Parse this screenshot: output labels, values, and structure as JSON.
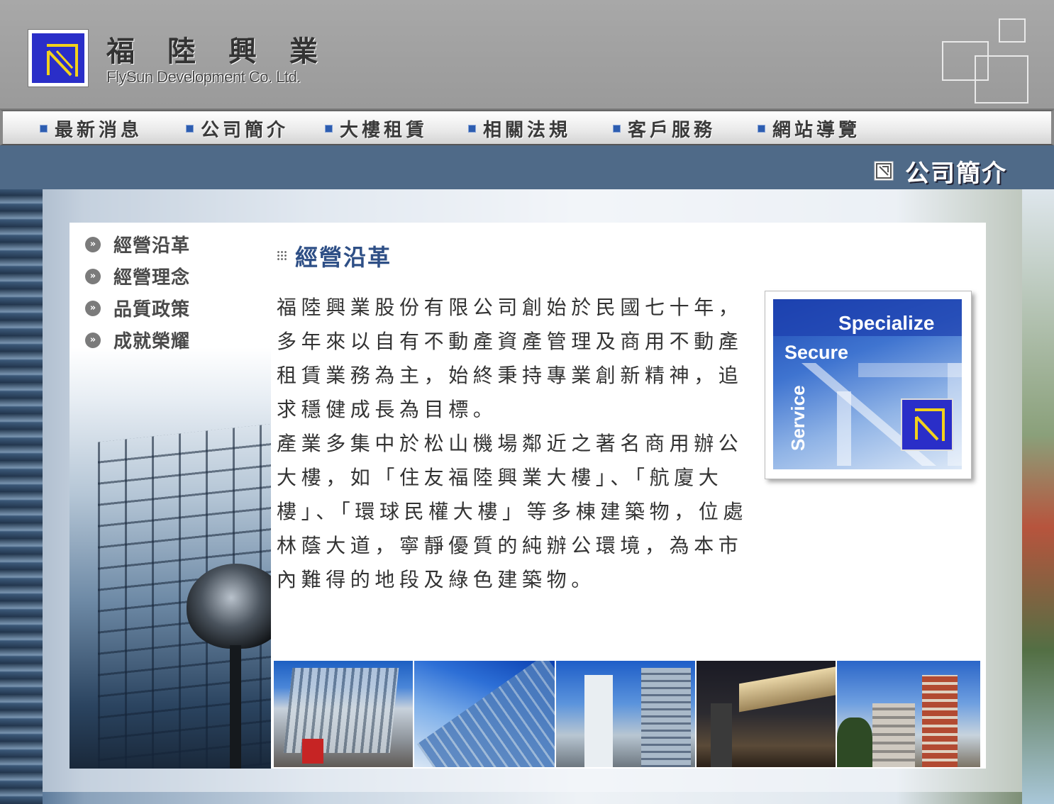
{
  "header": {
    "brand_cn": "福陸興業",
    "brand_en": "FlySun Development Co. Ltd."
  },
  "nav": {
    "items": [
      {
        "label": "最新消息"
      },
      {
        "label": "公司簡介"
      },
      {
        "label": "大樓租賃"
      },
      {
        "label": "相關法規"
      },
      {
        "label": "客戶服務"
      },
      {
        "label": "網站導覽"
      }
    ]
  },
  "page": {
    "title": "公司簡介"
  },
  "side_menu": {
    "items": [
      {
        "label": "經營沿革"
      },
      {
        "label": "經營理念"
      },
      {
        "label": "品質政策"
      },
      {
        "label": "成就榮耀"
      }
    ]
  },
  "content": {
    "section_title": "經營沿革",
    "paragraph_1": "福陸興業股份有限公司創始於民國七十年，多年來以自有不動產資產管理及商用不動產租賃業務為主，始終秉持專業創新精神，追求穩健成長為目標。",
    "paragraph_2": "產業多集中於松山機場鄰近之著名商用辦公大樓，如「住友福陸興業大樓」、「航廈大樓」、「環球民權大樓」等多棟建築物，位處林蔭大道，寧靜優質的純辦公環境，為本市內難得的地段及綠色建築物。"
  },
  "feature": {
    "word_1": "Specialize",
    "word_2": "Secure",
    "word_3": "Service"
  },
  "colors": {
    "title_bar": "#4f6a88",
    "nav_bullet": "#2d5db0",
    "section_title": "#2e4f86",
    "logo_blue": "#2a2ec8",
    "logo_yellow": "#f2d21b"
  }
}
